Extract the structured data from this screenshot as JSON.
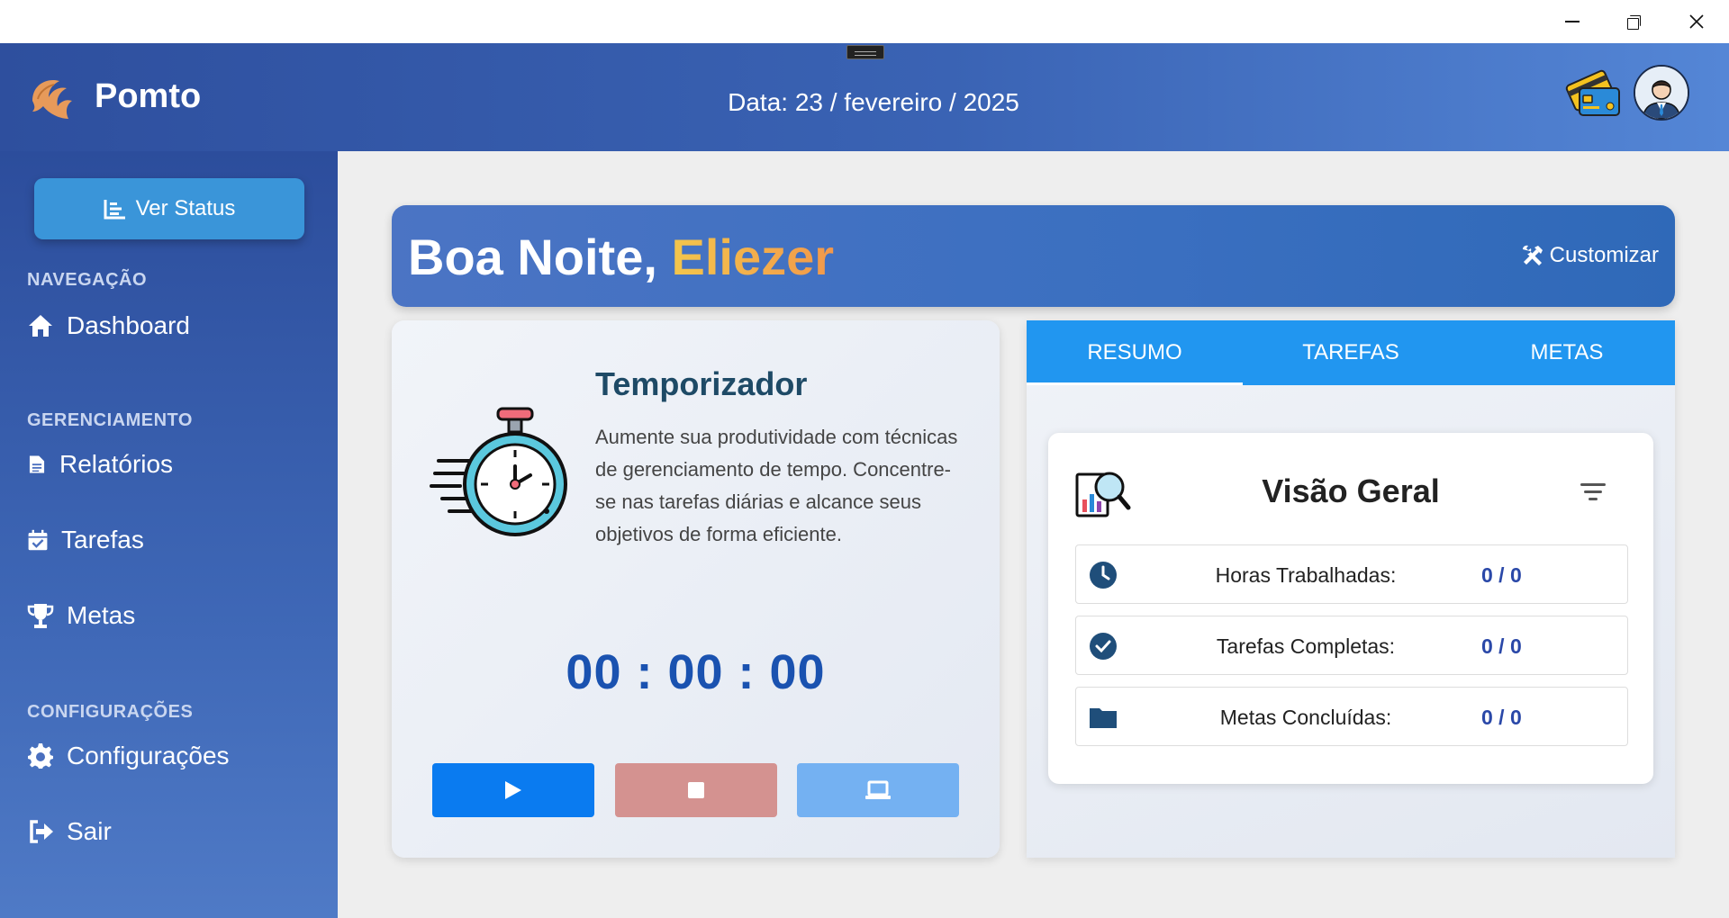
{
  "app": {
    "name": "Pomto"
  },
  "header": {
    "date": "Data: 23 / fevereiro / 2025"
  },
  "sidebar": {
    "status_button": "Ver Status",
    "sections": {
      "navigation": "NAVEGAÇÃO",
      "management": "GERENCIAMENTO",
      "settings": "CONFIGURAÇÕES"
    },
    "items": {
      "dashboard": "Dashboard",
      "reports": "Relatórios",
      "tasks": "Tarefas",
      "goals": "Metas",
      "settings": "Configurações",
      "logout": "Sair"
    }
  },
  "greeting": {
    "prefix": "Boa Noite, ",
    "name": "Eliezer",
    "customize": "Customizar"
  },
  "timer": {
    "title": "Temporizador",
    "description": "Aumente sua produtividade com técnicas de gerenciamento de tempo. Concentre-se nas tarefas diárias e alcance seus objetivos de forma eficiente.",
    "time": "00 : 00 : 00"
  },
  "tabs": {
    "items": [
      "RESUMO",
      "TAREFAS",
      "METAS"
    ],
    "active": "RESUMO"
  },
  "overview": {
    "title": "Visão Geral",
    "rows": [
      {
        "label": "Horas Trabalhadas:",
        "value": "0 / 0",
        "icon": "clock-icon"
      },
      {
        "label": "Tarefas Completas:",
        "value": "0 / 0",
        "icon": "check-circle-icon"
      },
      {
        "label": "Metas Concluídas:",
        "value": "0 / 0",
        "icon": "folder-icon"
      }
    ]
  },
  "colors": {
    "sidebar": "#2c4d9c",
    "header": "#3a63b4",
    "primary_button": "#0a7bf0",
    "tab_bar": "#2196f0",
    "stop_button": "#d49290",
    "screen_button": "#74b1f2",
    "value_text": "#2a48a8"
  }
}
